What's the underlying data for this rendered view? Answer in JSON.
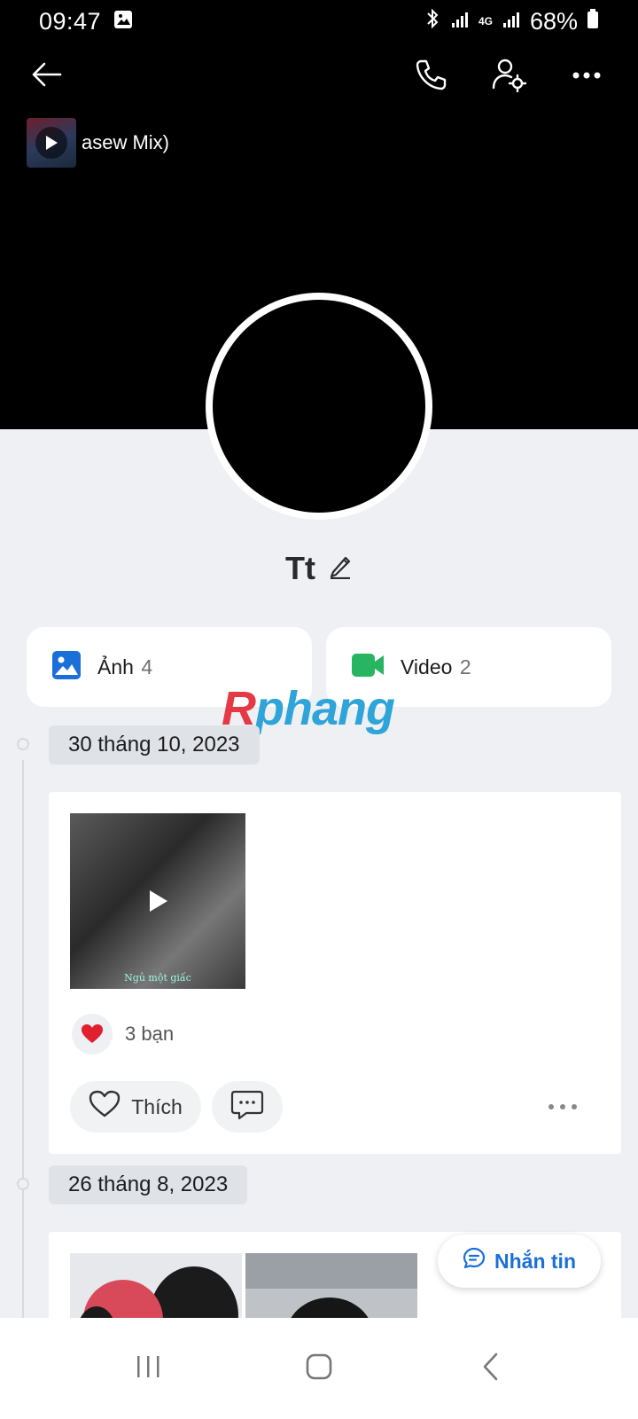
{
  "status_bar": {
    "time": "09:47",
    "network": "4G",
    "battery": "68%"
  },
  "header": {
    "back_icon": "arrow-left-icon",
    "call_icon": "phone-icon",
    "settings_icon": "user-settings-icon",
    "more_icon": "more-horizontal-icon"
  },
  "music": {
    "title": "asew Mix)"
  },
  "profile": {
    "name": "Tt",
    "edit_icon": "pencil-icon"
  },
  "media": {
    "photos": {
      "label": "Ảnh",
      "count": "4",
      "icon": "image-icon",
      "color": "#1a6fd8"
    },
    "videos": {
      "label": "Video",
      "count": "2",
      "icon": "video-camera-icon",
      "color": "#27b562"
    }
  },
  "watermark": {
    "first": "R",
    "rest": "phang"
  },
  "timeline": [
    {
      "date": "30 tháng 10, 2023",
      "video_caption": "Ngủ một giấc",
      "reaction_count": "3 bạn",
      "like_label": "Thích"
    },
    {
      "date": "26 tháng 8, 2023"
    }
  ],
  "message_button": {
    "label": "Nhắn tin",
    "color": "#1a6fd8"
  },
  "colors": {
    "accent": "#1a6fd8",
    "reaction_heart": "#e0202e",
    "background": "#eef0f4"
  }
}
